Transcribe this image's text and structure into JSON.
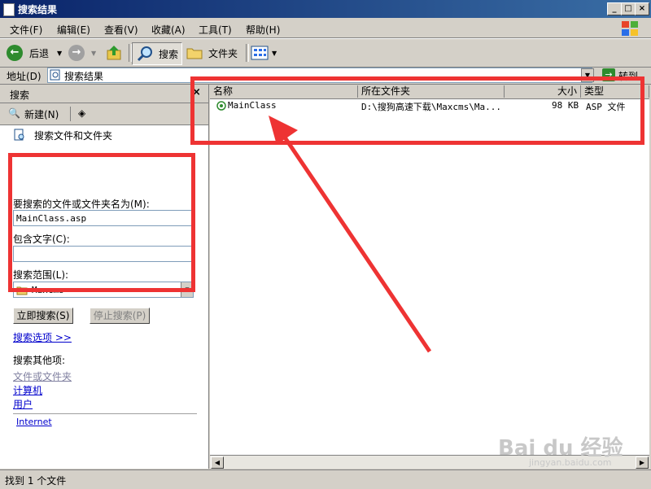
{
  "window": {
    "title": "搜索结果",
    "controls": [
      "_",
      "□",
      "×"
    ]
  },
  "menu": [
    "文件(F)",
    "编辑(E)",
    "查看(V)",
    "收藏(A)",
    "工具(T)",
    "帮助(H)"
  ],
  "toolbar": {
    "back_label": "后退",
    "search_label": "搜索",
    "folders_label": "文件夹"
  },
  "address": {
    "label": "地址(D)",
    "value": "搜索结果",
    "go_label": "转到"
  },
  "search_pane": {
    "title": "搜索",
    "new_label": "新建(N)",
    "heading": "搜索文件和文件夹",
    "name_label": "要搜索的文件或文件夹名为(M):",
    "name_value": "MainClass.asp",
    "contains_label": "包含文字(C):",
    "contains_value": "",
    "scope_label": "搜索范围(L):",
    "scope_value": "Maxcms",
    "search_now": "立即搜索(S)",
    "stop_search": "停止搜索(P)",
    "options_link": "搜索选项 >>",
    "other_label": "搜索其他项:",
    "other_items": [
      "文件或文件夹",
      "计算机",
      "用户"
    ],
    "internet_link": "Internet"
  },
  "results": {
    "columns": [
      "名称",
      "所在文件夹",
      "大小",
      "类型"
    ],
    "rows": [
      {
        "name": "MainClass",
        "folder": "D:\\搜狗高速下载\\Maxcms\\Ma...",
        "size": "98 KB",
        "type": "ASP 文件"
      }
    ]
  },
  "status": {
    "text": "找到 1 个文件"
  },
  "watermark": {
    "text": "Bai du 经验",
    "sub": "jingyan.baidu.com"
  },
  "colors": {
    "annotation": "#ee3333",
    "titlebar": "#0a246a",
    "link": "#0000cc"
  }
}
